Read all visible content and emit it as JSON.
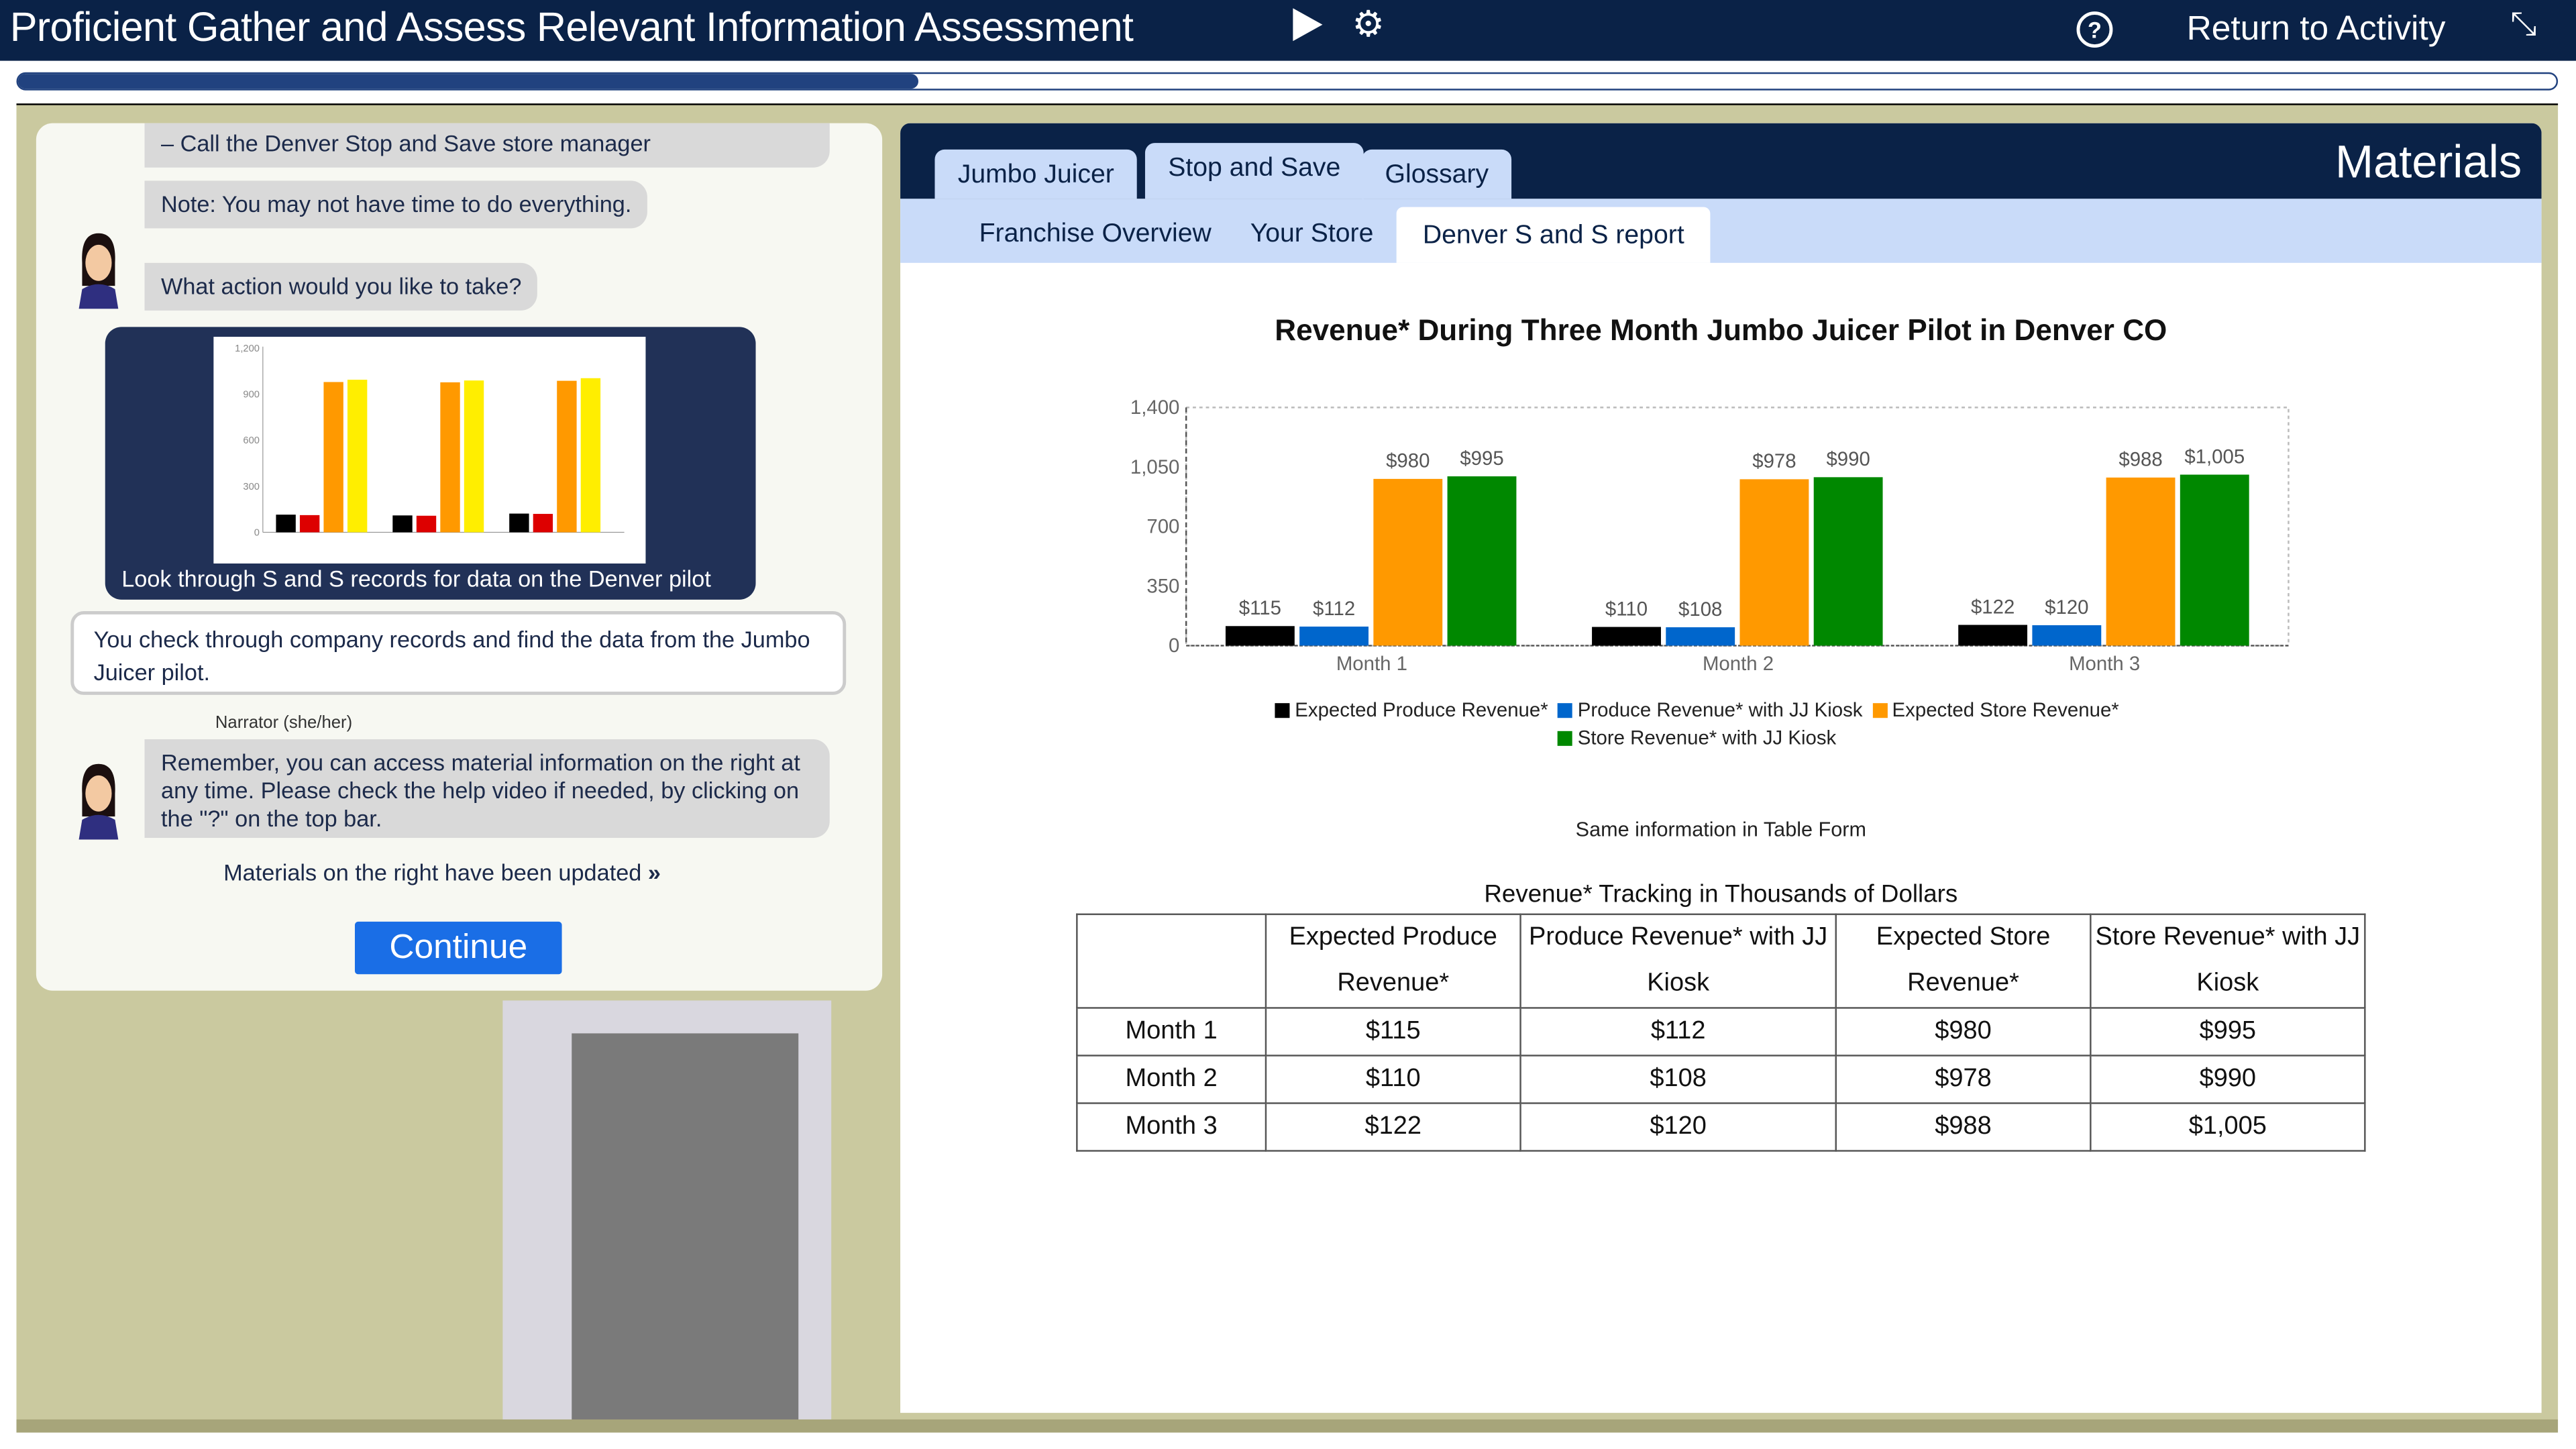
{
  "header": {
    "title": "Proficient Gather and Assess Relevant Information Assessment",
    "return_label": "Return to Activity",
    "help_label": "?",
    "icons": [
      "play-icon",
      "gear-icon",
      "help-icon",
      "compress-icon"
    ]
  },
  "progress": {
    "percent": 35.5,
    "color": "#21427f"
  },
  "chat": {
    "messages": [
      {
        "text": "–  Call the Denver Stop and Save store manager"
      },
      {
        "text": "Note: You may not have time to do everything."
      },
      {
        "text": "What action would you like to take?"
      }
    ],
    "image_option": {
      "caption": "Look through S and S records for data on the Denver pilot",
      "thumbnail_ticks": [
        "1,200",
        "900",
        "600",
        "300",
        "0"
      ]
    },
    "user_reply": "You check through company records and find the data from the Jumbo Juicer pilot.",
    "narrator_label": "Narrator (she/her)",
    "narrator_message": "Remember, you can access material information on the right at any time. Please check the help video if needed, by clicking on the \"?\" on the top bar.",
    "updated_notice": "Materials on the right have been updated",
    "updated_icon": "»",
    "continue_label": "Continue"
  },
  "materials": {
    "title": "Materials",
    "tabs": [
      {
        "label": "Jumbo Juicer"
      },
      {
        "label": "Stop and Save",
        "active": true
      },
      {
        "label": "Glossary"
      }
    ],
    "subtabs": [
      {
        "label": "Franchise Overview"
      },
      {
        "label": "Your Store"
      },
      {
        "label": "Denver S and S report",
        "active": true
      }
    ],
    "same_info_label": "Same information in Table Form",
    "table": {
      "caption": "Revenue* Tracking in Thousands of Dollars",
      "headers": [
        "",
        "Expected Produce Revenue*",
        "Produce Revenue* with JJ Kiosk",
        "Expected Store Revenue*",
        "Store Revenue* with JJ Kiosk"
      ],
      "rows": [
        [
          "Month 1",
          "$115",
          "$112",
          "$980",
          "$995"
        ],
        [
          "Month 2",
          "$110",
          "$108",
          "$978",
          "$990"
        ],
        [
          "Month 3",
          "$122",
          "$120",
          "$988",
          "$1,005"
        ]
      ]
    }
  },
  "chart_data": {
    "type": "bar",
    "title": "Revenue* During Three Month Jumbo Juicer Pilot in Denver CO",
    "categories": [
      "Month 1",
      "Month 2",
      "Month 3"
    ],
    "ylim": [
      0,
      1400
    ],
    "yticks": [
      "0",
      "350",
      "700",
      "1,050",
      "1,400"
    ],
    "grid": false,
    "legend_position": "bottom",
    "series": [
      {
        "name": "Expected Produce Revenue*",
        "color": "#000000",
        "values": [
          115,
          110,
          122
        ],
        "labels": [
          "$115",
          "$110",
          "$122"
        ]
      },
      {
        "name": "Produce Revenue* with JJ Kiosk",
        "color": "#0066cc",
        "values": [
          112,
          108,
          120
        ],
        "labels": [
          "$112",
          "$108",
          "$120"
        ]
      },
      {
        "name": "Expected Store Revenue*",
        "color": "#ff9900",
        "values": [
          980,
          978,
          988
        ],
        "labels": [
          "$980",
          "$978",
          "$988"
        ]
      },
      {
        "name": "Store Revenue* with JJ Kiosk",
        "color": "#008800",
        "values": [
          995,
          990,
          1005
        ],
        "labels": [
          "$995",
          "$990",
          "$1,005"
        ]
      }
    ]
  }
}
